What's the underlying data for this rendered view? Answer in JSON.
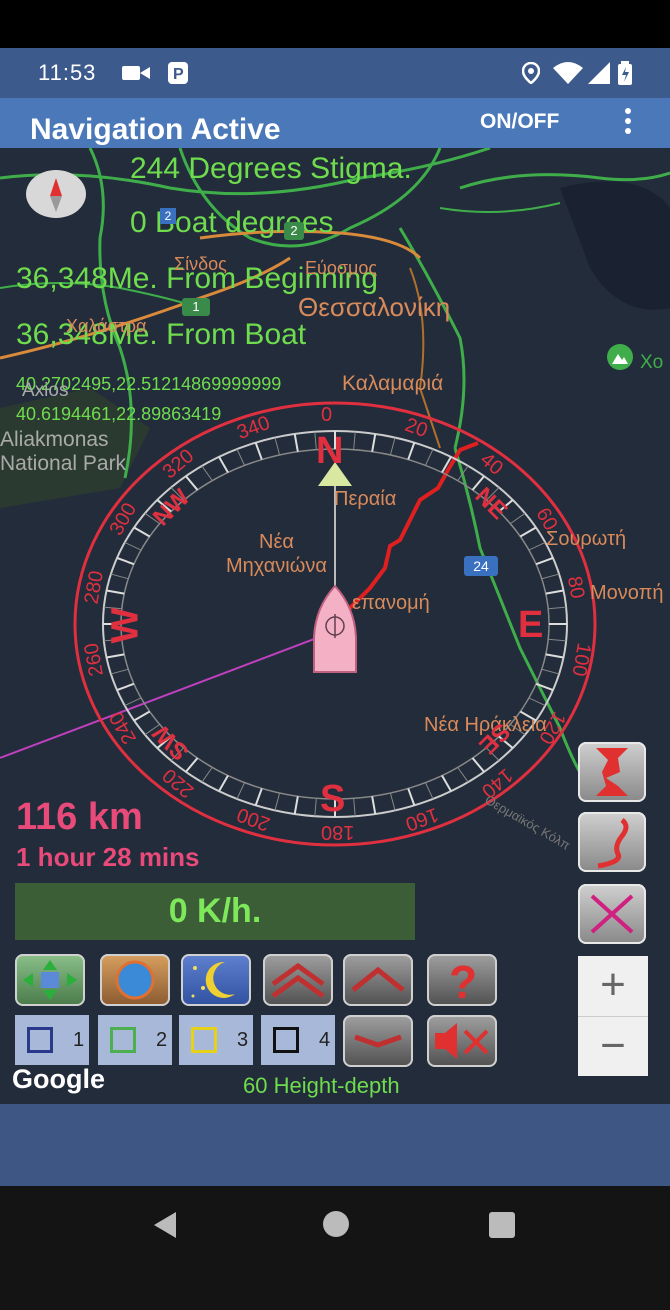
{
  "status_bar": {
    "time": "11:53"
  },
  "app_bar": {
    "title": "Navigation Active",
    "onoff_label": "ON/OFF"
  },
  "info": {
    "heading": "244 Degrees Stigma.",
    "boat_degrees": "0 Boat degrees",
    "from_beginning": "36,348Me. From Beginning",
    "from_boat": "36,348Me. From Boat",
    "coords1": "40.2702495,22.51214869999999",
    "coords2": "40.6194461,22.89863419"
  },
  "map_labels": {
    "sindos": "Σίνδος",
    "efosmos": "Εύοσμος",
    "thessaloniki": "Θεσσαλονίκη",
    "kalamaria": "Καλαμαριά",
    "axios": "Axios",
    "aliakmonas": "Aliakmonas",
    "national_park": "National Park",
    "chalastra": "Χαλάστρα",
    "peraia": "Περαία",
    "nea_mixaniona": "Νέα\nΜηχανιώνα",
    "epanomi": "επανομή",
    "sourotti": "Σουρωτή",
    "monopigado": "Μονοπή",
    "nea_irakleia": "Νέα Ηράκλεια",
    "kolpos": "Θερμαϊκός Κόλπ",
    "road_24": "24",
    "road_2": "2",
    "road_1": "1",
    "xo": "Χο"
  },
  "compass": {
    "cardinal": {
      "n": "N",
      "e": "E",
      "s": "S",
      "w": "W"
    },
    "inter": {
      "ne": "NE",
      "se": "SE",
      "sw": "SW",
      "nw": "NW"
    },
    "degrees": [
      "0",
      "20",
      "40",
      "60",
      "80",
      "100",
      "120",
      "140",
      "160",
      "180",
      "200",
      "220",
      "240",
      "260",
      "280",
      "300",
      "320",
      "340"
    ]
  },
  "route": {
    "distance": "116 km",
    "duration": "1 hour 28 mins"
  },
  "speed": "0  K/h.",
  "checkboxes": [
    {
      "num": "1",
      "color": "#2a3a8a"
    },
    {
      "num": "2",
      "color": "#4caf50"
    },
    {
      "num": "3",
      "color": "#e6d21a"
    },
    {
      "num": "4",
      "color": "#111111"
    }
  ],
  "zoom": {
    "in": "+",
    "out": "−"
  },
  "google": "Google",
  "height_depth": "60 Height-depth",
  "colors": {
    "info_green": "#6fdc4e",
    "route_pink": "#e84a7a",
    "compass_red": "#e03040",
    "app_bar": "#4a78b8"
  }
}
